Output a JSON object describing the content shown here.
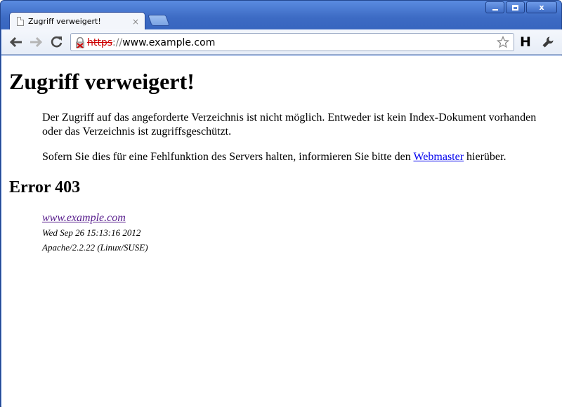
{
  "browser": {
    "tab": {
      "title": "Zugriff verweigert!",
      "close_glyph": "×"
    },
    "window_controls": {
      "close_glyph": "x"
    },
    "address_bar": {
      "scheme": "https",
      "separator": "://",
      "host": "www.example.com"
    },
    "extension_label": "H",
    "icons": [
      "back-icon",
      "forward-icon",
      "reload-icon",
      "broken-lock-icon",
      "star-icon",
      "wrench-icon",
      "page-icon",
      "new-tab-icon"
    ],
    "colors": {
      "frame": "#3f6fc7",
      "url_error": "#cc0000",
      "link": "#0000ee",
      "visited_link": "#551a8b"
    }
  },
  "page": {
    "heading": "Zugriff verweigert!",
    "paragraph1": "Der Zugriff auf das angeforderte Verzeichnis ist nicht möglich. Entweder ist kein Index-Dokument vorhanden oder das Verzeichnis ist zugriffsgeschützt.",
    "paragraph2_before": "Sofern Sie dies für eine Fehlfunktion des Servers halten, informieren Sie bitte den ",
    "paragraph2_link": "Webmaster",
    "paragraph2_after": " hierüber.",
    "error_heading": "Error 403",
    "address": {
      "host_link": "www.example.com",
      "date": "Wed Sep 26 15:13:16 2012",
      "server": "Apache/2.2.22 (Linux/SUSE)"
    }
  }
}
